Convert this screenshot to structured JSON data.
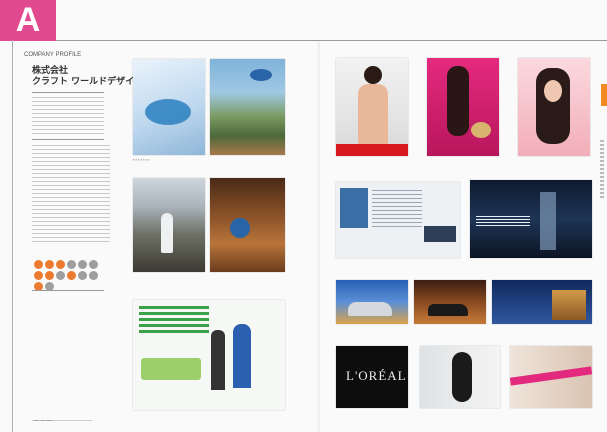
{
  "tab_label": "A",
  "left_page": {
    "section_label": "COMPANY PROFILE",
    "company_name": "株式会社",
    "company_subtitle": "クラフト ワールドデザイン"
  },
  "colors": {
    "tab_pink": "#e24a8f",
    "accent_orange": "#f08a24",
    "dot_orange": "#ec7b2f",
    "dot_grey": "#9e9e9e"
  },
  "ad_brand": "L'ORÉAL"
}
